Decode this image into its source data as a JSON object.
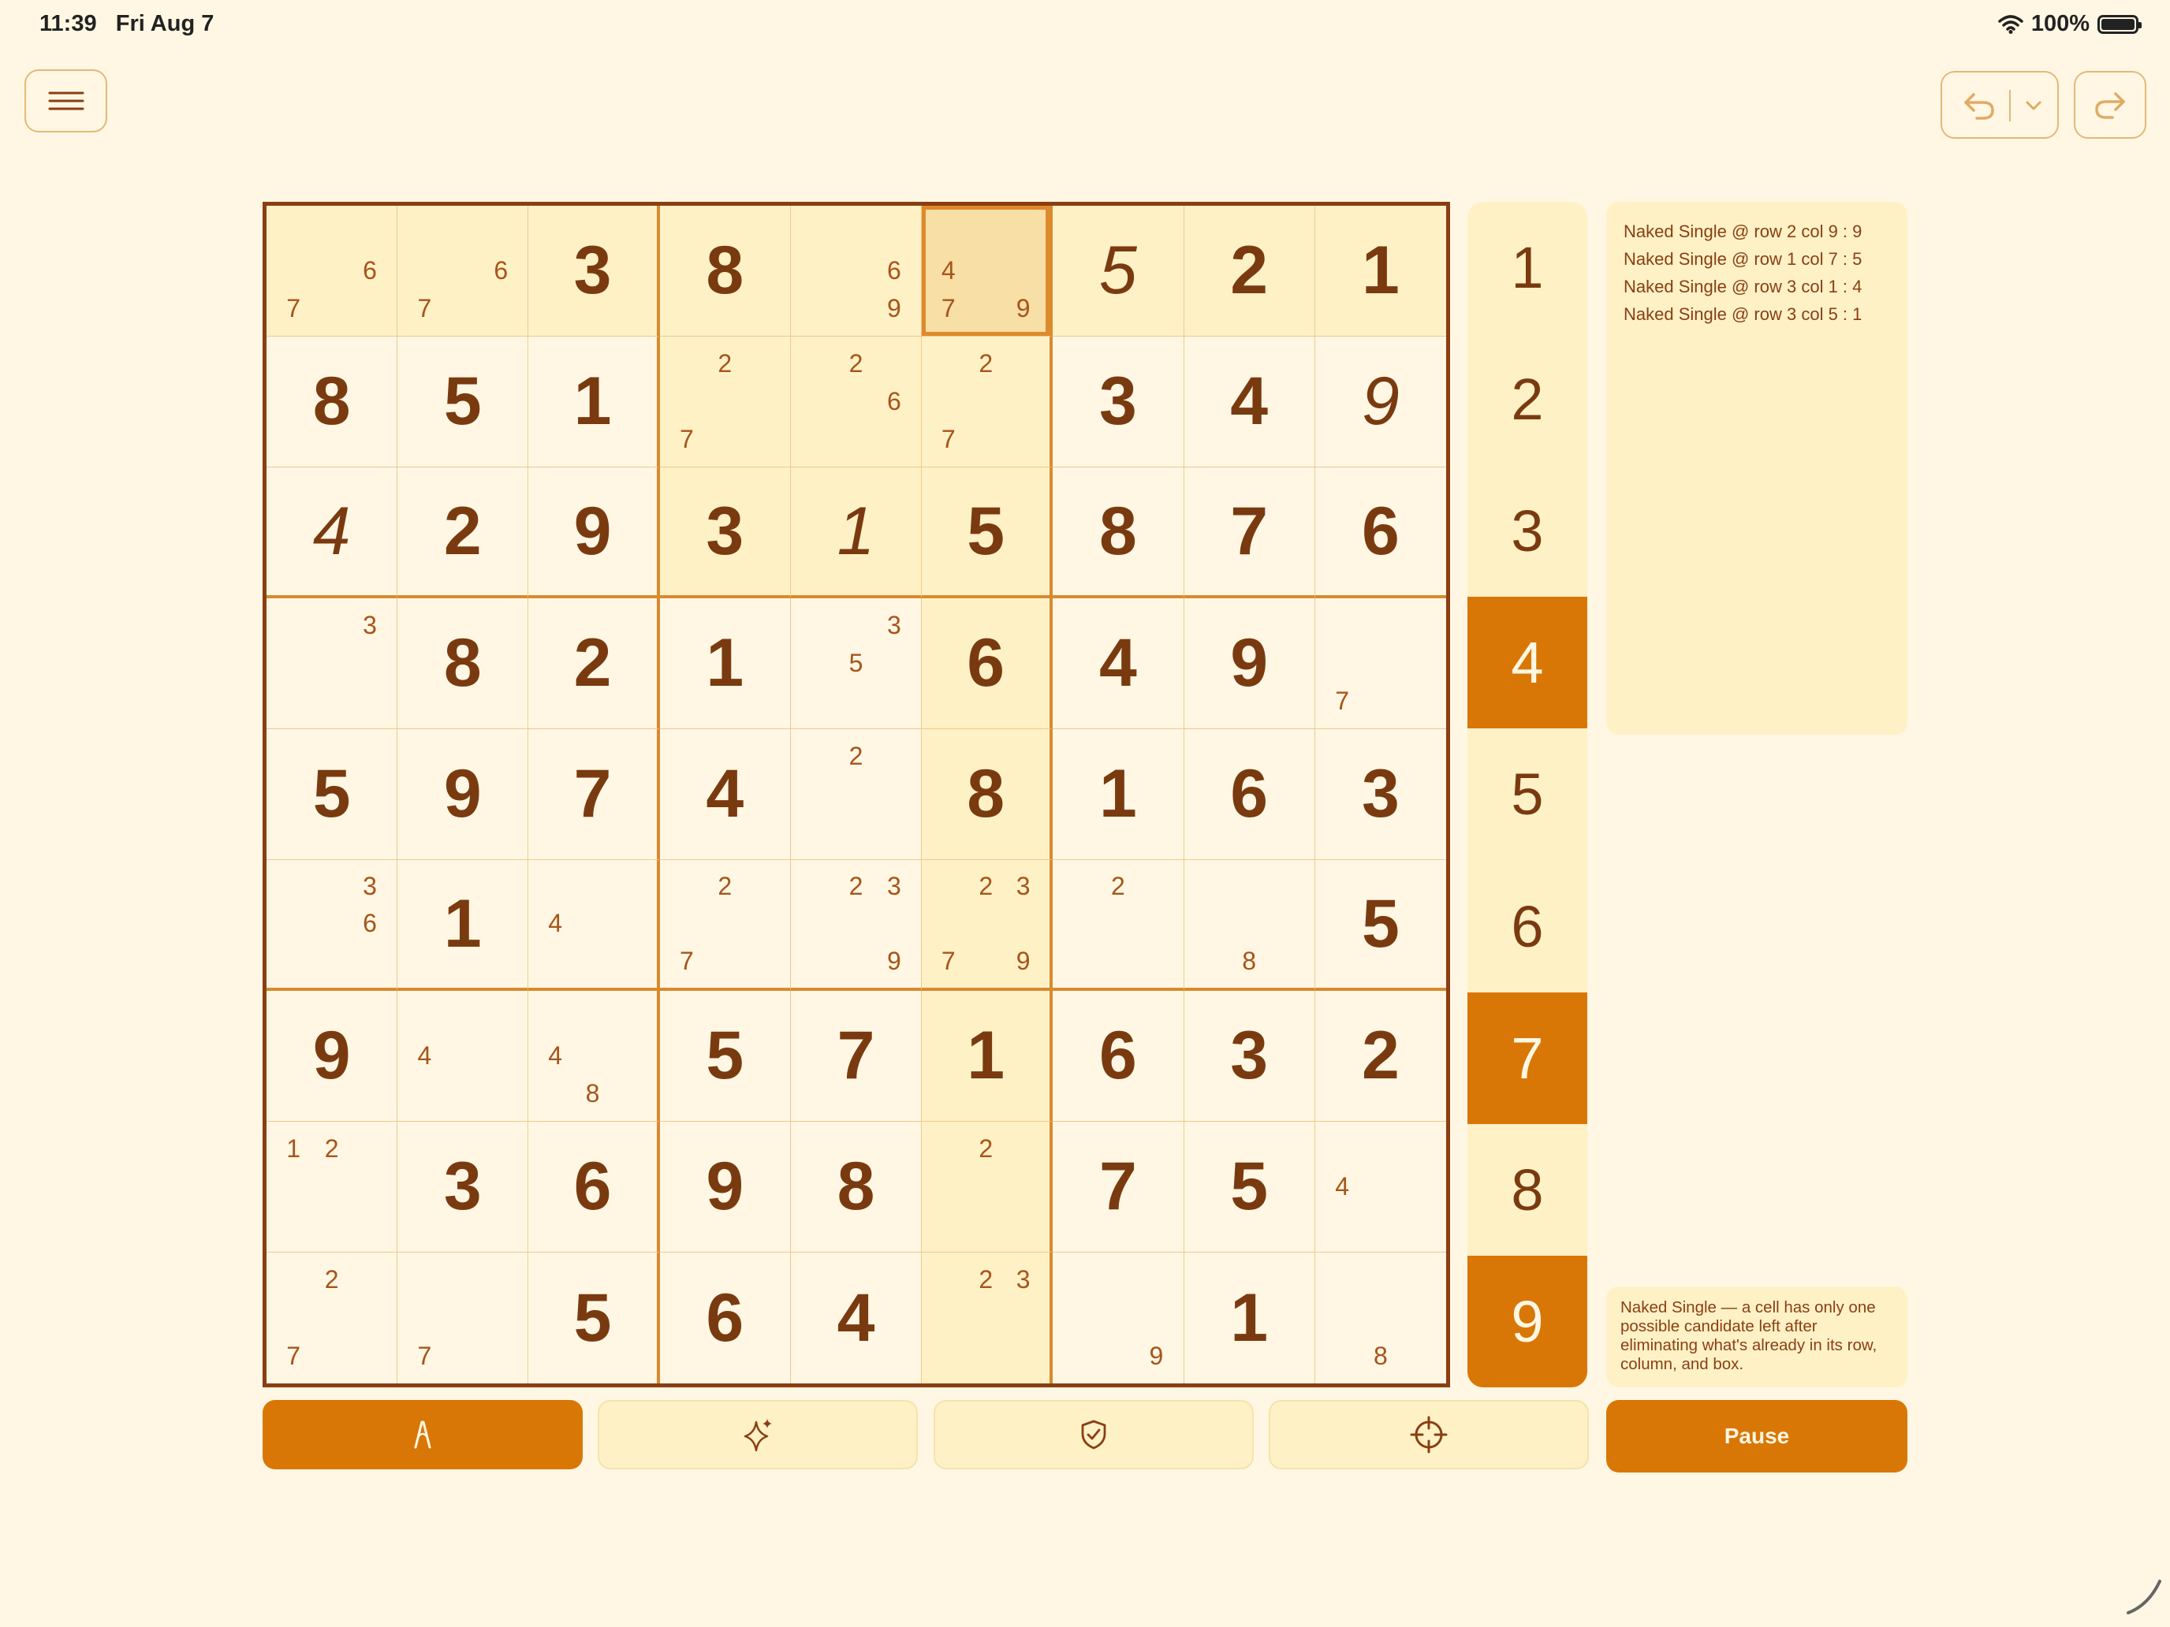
{
  "status_bar": {
    "time": "11:39",
    "date": "Fri Aug 7",
    "battery": "100%"
  },
  "icons": {
    "menu": "hamburger-menu-icon",
    "undo": "undo-arrow-icon",
    "undo_dropdown": "chevron-down-icon",
    "redo": "redo-arrow-icon",
    "pencil": "pencil-icon",
    "magic": "sparkles-icon",
    "check": "shield-check-icon",
    "target": "crosshair-icon"
  },
  "colors": {
    "background": "#fff7e3",
    "accent": "#d97706",
    "text": "#7a3a10",
    "highlight": "#fff1c6"
  },
  "board": {
    "selected": [
      0,
      5
    ],
    "cells": [
      [
        {
          "c": [
            6,
            7
          ]
        },
        {
          "c": [
            6,
            7
          ]
        },
        {
          "v": 3
        },
        {
          "v": 8
        },
        {
          "c": [
            6,
            9
          ]
        },
        {
          "c": [
            4,
            7,
            9
          ]
        },
        {
          "v": 5,
          "u": true
        },
        {
          "v": 2
        },
        {
          "v": 1
        }
      ],
      [
        {
          "v": 8
        },
        {
          "v": 5
        },
        {
          "v": 1
        },
        {
          "c": [
            2,
            7
          ]
        },
        {
          "c": [
            2,
            6
          ]
        },
        {
          "c": [
            2,
            7
          ]
        },
        {
          "v": 3
        },
        {
          "v": 4
        },
        {
          "v": 9,
          "u": true
        }
      ],
      [
        {
          "v": 4,
          "u": true
        },
        {
          "v": 2
        },
        {
          "v": 9
        },
        {
          "v": 3
        },
        {
          "v": 1,
          "u": true
        },
        {
          "v": 5
        },
        {
          "v": 8
        },
        {
          "v": 7
        },
        {
          "v": 6
        }
      ],
      [
        {
          "c": [
            3
          ]
        },
        {
          "v": 8
        },
        {
          "v": 2
        },
        {
          "v": 1
        },
        {
          "c": [
            3,
            5
          ]
        },
        {
          "v": 6
        },
        {
          "v": 4
        },
        {
          "v": 9
        },
        {
          "c": [
            7
          ]
        }
      ],
      [
        {
          "v": 5
        },
        {
          "v": 9
        },
        {
          "v": 7
        },
        {
          "v": 4
        },
        {
          "c": [
            2
          ]
        },
        {
          "v": 8
        },
        {
          "v": 1
        },
        {
          "v": 6
        },
        {
          "v": 3
        }
      ],
      [
        {
          "c": [
            3,
            6
          ]
        },
        {
          "v": 1
        },
        {
          "c": [
            4
          ]
        },
        {
          "c": [
            2,
            7
          ]
        },
        {
          "c": [
            2,
            3,
            9
          ]
        },
        {
          "c": [
            2,
            3,
            7,
            9
          ]
        },
        {
          "c": [
            2
          ]
        },
        {
          "c": [
            8
          ]
        },
        {
          "v": 5
        }
      ],
      [
        {
          "v": 9
        },
        {
          "c": [
            4
          ]
        },
        {
          "c": [
            4,
            8
          ]
        },
        {
          "v": 5
        },
        {
          "v": 7
        },
        {
          "v": 1
        },
        {
          "v": 6
        },
        {
          "v": 3
        },
        {
          "v": 2
        }
      ],
      [
        {
          "c": [
            1,
            2
          ]
        },
        {
          "v": 3
        },
        {
          "v": 6
        },
        {
          "v": 9
        },
        {
          "v": 8
        },
        {
          "c": [
            2
          ]
        },
        {
          "v": 7
        },
        {
          "v": 5
        },
        {
          "c": [
            4
          ]
        }
      ],
      [
        {
          "c": [
            2,
            7
          ]
        },
        {
          "c": [
            7
          ]
        },
        {
          "v": 5
        },
        {
          "v": 6
        },
        {
          "v": 4
        },
        {
          "c": [
            2,
            3
          ]
        },
        {
          "c": [
            9
          ]
        },
        {
          "v": 1
        },
        {
          "c": [
            8
          ]
        }
      ]
    ]
  },
  "numpad": [
    {
      "label": "1",
      "active": false
    },
    {
      "label": "2",
      "active": false
    },
    {
      "label": "3",
      "active": false
    },
    {
      "label": "4",
      "active": true
    },
    {
      "label": "5",
      "active": false
    },
    {
      "label": "6",
      "active": false
    },
    {
      "label": "7",
      "active": true
    },
    {
      "label": "8",
      "active": false
    },
    {
      "label": "9",
      "active": true
    }
  ],
  "log": [
    "Naked Single @ row 2 col 9 : 9",
    "Naked Single @ row 1 col 7 : 5",
    "Naked Single @ row 3 col 1 : 4",
    "Naked Single @ row 3 col 5 : 1"
  ],
  "hint": "Naked Single — a cell has only one possible candidate left after eliminating what's already in its row, column, and box.",
  "pause_label": "Pause"
}
